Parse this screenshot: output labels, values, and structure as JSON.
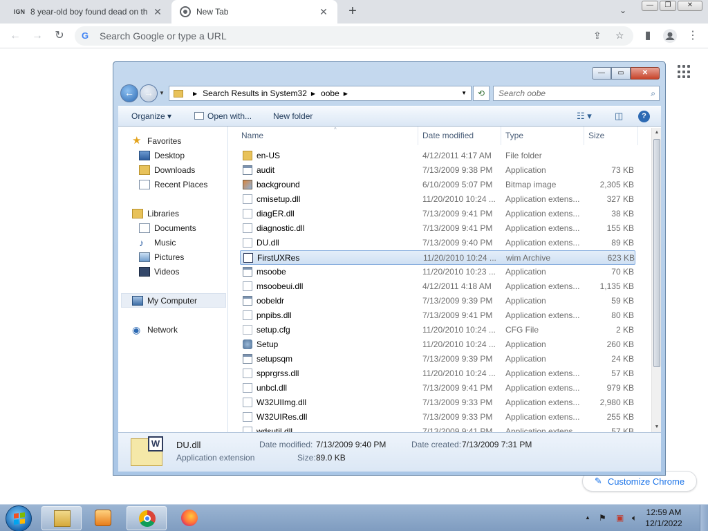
{
  "browser": {
    "tabs": [
      {
        "favicon": "IGN",
        "title": "8 year-old boy found dead on th",
        "close": "✕"
      },
      {
        "favicon": "chrome-icon",
        "title": "New Tab",
        "close": "✕"
      }
    ],
    "new_tab": "+",
    "tab_search": "⌄",
    "window_controls": {
      "minimize": "—",
      "maximize": "❐",
      "close": "✕"
    },
    "omnibox_placeholder": "Search Google or type a URL",
    "customize_label": "Customize Chrome"
  },
  "explorer": {
    "breadcrumb": [
      "Search Results in System32",
      "oobe"
    ],
    "search_placeholder": "Search oobe",
    "commands": {
      "organize": "Organize ▾",
      "open_with": "Open with...",
      "new_folder": "New folder"
    },
    "nav": {
      "favorites": "Favorites",
      "desktop": "Desktop",
      "downloads": "Downloads",
      "recent": "Recent Places",
      "libraries": "Libraries",
      "documents": "Documents",
      "music": "Music",
      "pictures": "Pictures",
      "videos": "Videos",
      "computer": "My Computer",
      "network": "Network"
    },
    "columns": {
      "name": "Name",
      "date": "Date modified",
      "type": "Type",
      "size": "Size"
    },
    "files": [
      {
        "icon": "folder",
        "name": "en-US",
        "date": "4/12/2011 4:17 AM",
        "type": "File folder",
        "size": ""
      },
      {
        "icon": "app",
        "name": "audit",
        "date": "7/13/2009 9:38 PM",
        "type": "Application",
        "size": "73 KB"
      },
      {
        "icon": "bmp",
        "name": "background",
        "date": "6/10/2009 5:07 PM",
        "type": "Bitmap image",
        "size": "2,305 KB"
      },
      {
        "icon": "dll",
        "name": "cmisetup.dll",
        "date": "11/20/2010 10:24 ...",
        "type": "Application extens...",
        "size": "327 KB"
      },
      {
        "icon": "dll",
        "name": "diagER.dll",
        "date": "7/13/2009 9:41 PM",
        "type": "Application extens...",
        "size": "38 KB"
      },
      {
        "icon": "dll",
        "name": "diagnostic.dll",
        "date": "7/13/2009 9:41 PM",
        "type": "Application extens...",
        "size": "155 KB"
      },
      {
        "icon": "dll",
        "name": "DU.dll",
        "date": "7/13/2009 9:40 PM",
        "type": "Application extens...",
        "size": "89 KB"
      },
      {
        "icon": "wim",
        "name": "FirstUXRes",
        "date": "11/20/2010 10:24 ...",
        "type": "wim Archive",
        "size": "623 KB"
      },
      {
        "icon": "app",
        "name": "msoobe",
        "date": "11/20/2010 10:23 ...",
        "type": "Application",
        "size": "70 KB"
      },
      {
        "icon": "dll",
        "name": "msoobeui.dll",
        "date": "4/12/2011 4:18 AM",
        "type": "Application extens...",
        "size": "1,135 KB"
      },
      {
        "icon": "app",
        "name": "oobeldr",
        "date": "7/13/2009 9:39 PM",
        "type": "Application",
        "size": "59 KB"
      },
      {
        "icon": "dll",
        "name": "pnpibs.dll",
        "date": "7/13/2009 9:41 PM",
        "type": "Application extens...",
        "size": "80 KB"
      },
      {
        "icon": "cfg",
        "name": "setup.cfg",
        "date": "11/20/2010 10:24 ...",
        "type": "CFG File",
        "size": "2 KB"
      },
      {
        "icon": "setup",
        "name": "Setup",
        "date": "11/20/2010 10:24 ...",
        "type": "Application",
        "size": "260 KB"
      },
      {
        "icon": "app",
        "name": "setupsqm",
        "date": "7/13/2009 9:39 PM",
        "type": "Application",
        "size": "24 KB"
      },
      {
        "icon": "dll",
        "name": "spprgrss.dll",
        "date": "11/20/2010 10:24 ...",
        "type": "Application extens...",
        "size": "57 KB"
      },
      {
        "icon": "dll",
        "name": "unbcl.dll",
        "date": "7/13/2009 9:41 PM",
        "type": "Application extens...",
        "size": "979 KB"
      },
      {
        "icon": "dll",
        "name": "W32UIImg.dll",
        "date": "7/13/2009 9:33 PM",
        "type": "Application extens...",
        "size": "2,980 KB"
      },
      {
        "icon": "dll",
        "name": "W32UIRes.dll",
        "date": "7/13/2009 9:33 PM",
        "type": "Application extens...",
        "size": "255 KB"
      },
      {
        "icon": "dll",
        "name": "wdsutil.dll",
        "date": "7/13/2009 9:41 PM",
        "type": "Application extens...",
        "size": "57 KB"
      }
    ],
    "selected_index": 7,
    "details": {
      "name": "DU.dll",
      "type": "Application extension",
      "modified_label": "Date modified:",
      "modified": "7/13/2009 9:40 PM",
      "created_label": "Date created:",
      "created": "7/13/2009 7:31 PM",
      "size_label": "Size:",
      "size": "89.0 KB"
    }
  },
  "taskbar": {
    "apps": [
      "windows-explorer",
      "media-player",
      "google-chrome",
      "firefox"
    ],
    "time": "12:59 AM",
    "date": "12/1/2022"
  }
}
